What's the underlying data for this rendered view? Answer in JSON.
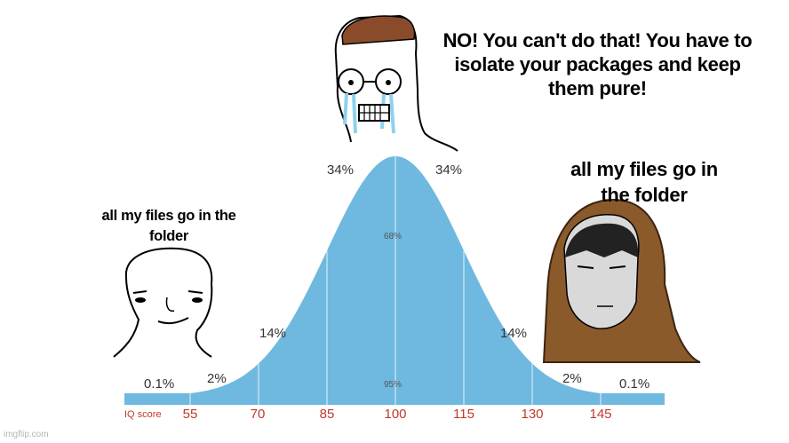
{
  "captions": {
    "top": "NO! You can't do that! You have to isolate your packages and keep them pure!",
    "right": "all my files go in the folder",
    "left": "all my files go in the folder"
  },
  "curve": {
    "band_labels": {
      "left_34": "34%",
      "right_34": "34%",
      "center_68": "68%",
      "left_14": "14%",
      "right_14": "14%",
      "left_2": "2%",
      "right_2": "2%",
      "left_01": "0.1%",
      "right_01": "0.1%",
      "center_95": "95%"
    },
    "axis_label": "IQ score",
    "ticks": [
      "55",
      "70",
      "85",
      "100",
      "115",
      "130",
      "145"
    ],
    "fill_color": "#6fb8e0",
    "axis_color": "#c0392b"
  },
  "watermark": "imgflip.com"
}
